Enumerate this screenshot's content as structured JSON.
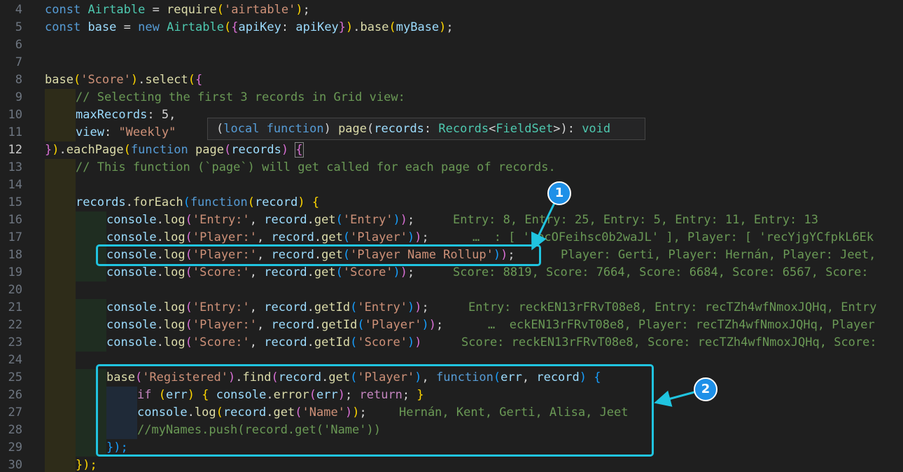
{
  "editor": {
    "line_numbers": [
      "4",
      "5",
      "6",
      "7",
      "8",
      "9",
      "10",
      "11",
      "12",
      "13",
      "14",
      "15",
      "16",
      "17",
      "18",
      "19",
      "20",
      "21",
      "22",
      "23",
      "24",
      "25",
      "26",
      "27",
      "28",
      "29",
      "30"
    ],
    "active_line": "12"
  },
  "code": {
    "l4": {
      "kw": "const",
      "name": "Airtable",
      "eq": " = ",
      "fn": "require",
      "po": "(",
      "str": "'airtable'",
      "pc": ")",
      "end": ";"
    },
    "l5": {
      "kw": "const",
      "name": "base",
      "eq": " = ",
      "new": "new",
      "cls": "Airtable",
      "po": "(",
      "bo": "{",
      "key": "apiKey",
      "colon": ": ",
      "val": "apiKey",
      "bc": "}",
      "pc": ")",
      "dot": ".",
      "prop": "base",
      "po2": "(",
      "arg": "myBase",
      "pc2": ")",
      "end": ";"
    },
    "l8": {
      "fn": "base",
      "po": "(",
      "str": "'Score'",
      "pc": ")",
      "dot": ".",
      "m": "select",
      "po2": "(",
      "bo": "{"
    },
    "l9": {
      "comment": "// Selecting the first 3 records in Grid view:"
    },
    "l10": {
      "key": "maxRecords",
      "rest": ": 5,"
    },
    "l11": {
      "key": "view",
      "colon": ": ",
      "str": "\"Weekly\""
    },
    "l12": {
      "bc": "}",
      "pc": ")",
      "dot": ".",
      "m": "eachPage",
      "po": "(",
      "kw": "function",
      "name": "page",
      "po2": "(",
      "arg": "records",
      "pc2": ")",
      "bo": "{"
    },
    "l13": {
      "comment": "// This function (`page`) will get called for each page of records."
    },
    "l15": {
      "obj": "records",
      "dot": ".",
      "m": "forEach",
      "po": "(",
      "kw": "function",
      "po2": "(",
      "arg": "record",
      "pc2": ")",
      "bo": "{"
    },
    "l16": {
      "obj": "console",
      "m": "log",
      "str": "'Entry:'",
      "rec": "record",
      "get": "get",
      "arg": "'Entry'"
    },
    "l17": {
      "obj": "console",
      "m": "log",
      "str": "'Player:'",
      "rec": "record",
      "get": "get",
      "arg": "'Player'"
    },
    "l18": {
      "obj": "console",
      "m": "log",
      "str": "'Player:'",
      "rec": "record",
      "get": "get",
      "arg": "'Player Name Rollup'"
    },
    "l19": {
      "obj": "console",
      "m": "log",
      "str": "'Score:'",
      "rec": "record",
      "get": "get",
      "arg": "'Score'"
    },
    "l21": {
      "obj": "console",
      "m": "log",
      "str": "'Entry:'",
      "rec": "record",
      "get": "getId",
      "arg": "'Entry'"
    },
    "l22": {
      "obj": "console",
      "m": "log",
      "str": "'Player:'",
      "rec": "record",
      "get": "getId",
      "arg": "'Player'"
    },
    "l23": {
      "obj": "console",
      "m": "log",
      "str": "'Score:'",
      "rec": "record",
      "get": "getId",
      "arg": "'Score'"
    },
    "l25": {
      "fn": "base",
      "str": "'Registered'",
      "m": "find",
      "rec": "record",
      "get": "get",
      "arg": "'Player'",
      "kw": "function",
      "err": "err",
      "arg2": "record"
    },
    "l26": {
      "kw": "if",
      "err": "err",
      "obj": "console",
      "m": "error",
      "ret": "return"
    },
    "l27": {
      "obj": "console",
      "m": "log",
      "rec": "record",
      "get": "get",
      "arg": "'Name'"
    },
    "l28": {
      "comment": "//myNames.push(record.get('Name'))"
    },
    "l29": {
      "text": "});"
    },
    "l30": {
      "text": "});"
    }
  },
  "inline_hints": {
    "l16": "Entry: 8, Entry: 25, Entry: 5, Entry: 11, Entry: 13",
    "l17": "…  : [ 'recOFeihsc0b2waJL' ], Player: [ 'recYjgYCfpkL6Ek",
    "l18": "Player: Gerti, Player: Hernán, Player: Jeet,",
    "l19": "Score: 8819, Score: 7664, Score: 6684, Score: 6567, Score:",
    "l21": "Entry: reckEN13rFRvT08e8, Entry: recTZh4wfNmoxJQHq, Entry",
    "l22": "…  eckEN13rFRvT08e8, Player: recTZh4wfNmoxJQHq, Player",
    "l23": "Score: reckEN13rFRvT08e8, Score: recTZh4wfNmoxJQHq, Score:",
    "l27": "Hernán, Kent, Gerti, Alisa, Jeet"
  },
  "tooltip": {
    "open": "(",
    "local": "local",
    "kw": "function",
    "close": ") ",
    "name": "page",
    "po": "(",
    "param": "records",
    "colon": ": ",
    "type": "Records",
    "lt": "<",
    "generic": "FieldSet",
    "gt": ">",
    "pc": ")",
    "sep": ": ",
    "ret": "void"
  },
  "annotations": {
    "badge1": "1",
    "badge2": "2",
    "color": "#20c4e0",
    "badge_color": "#1e90e8"
  }
}
